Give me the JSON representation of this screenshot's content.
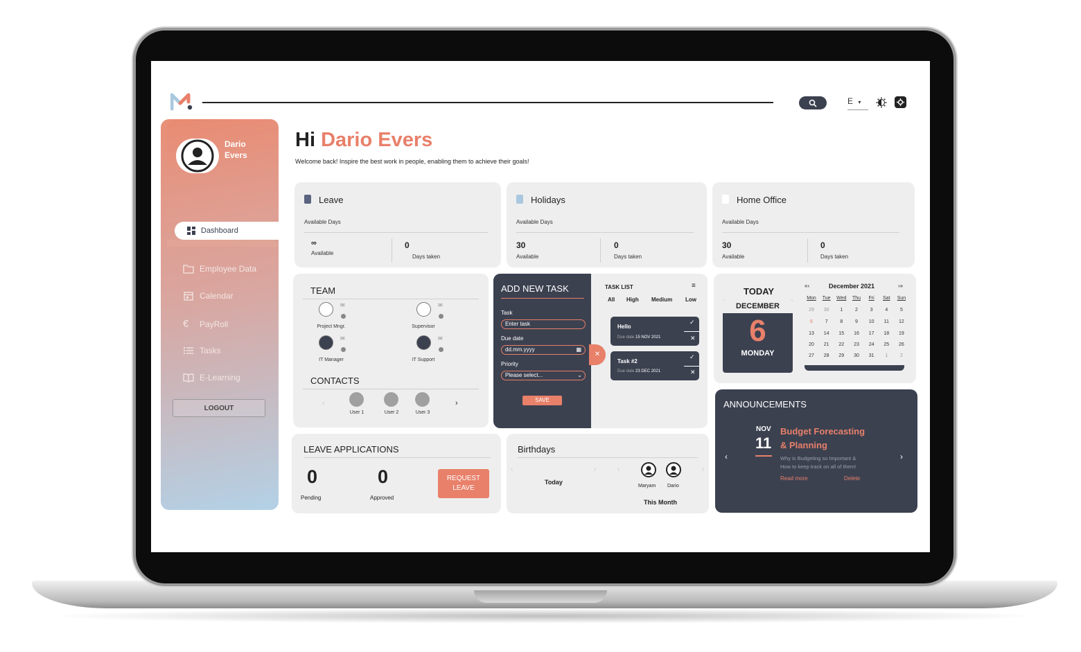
{
  "app": {
    "logo": "M-logo",
    "search_icon": "search-icon",
    "language": "E",
    "colors": {
      "accent": "#e8806a",
      "dark": "#3c4150",
      "card": "#eeeeee",
      "sidebar_top": "#e88f77",
      "sidebar_bottom": "#b3d1e6"
    }
  },
  "sidebar": {
    "user_first": "Dario",
    "user_last": "Evers",
    "active": "Dashboard",
    "items": [
      {
        "label": "Employee Data",
        "icon": "folder-icon"
      },
      {
        "label": "Calendar",
        "icon": "calendar-icon"
      },
      {
        "label": "PayRoll",
        "icon": "euro-icon"
      },
      {
        "label": "Tasks",
        "icon": "list-icon"
      },
      {
        "label": "E-Learning",
        "icon": "book-icon"
      }
    ],
    "logout": "LOGOUT"
  },
  "greeting": {
    "hi": "Hi",
    "name": "Dario Evers",
    "subtitle": "Welcome back! Inspire the best work in people, enabling them to achieve their goals!"
  },
  "stats": [
    {
      "title": "Leave",
      "subtitle": "Available Days",
      "available": "∞",
      "available_label": "Available",
      "taken": "0",
      "taken_label": "Days taken",
      "color": "#5a6480"
    },
    {
      "title": "Holidays",
      "subtitle": "Available Days",
      "available": "30",
      "available_label": "Available",
      "taken": "0",
      "taken_label": "Days taken",
      "color": "#a9c8df"
    },
    {
      "title": "Home Office",
      "subtitle": "Available Days",
      "available": "30",
      "available_label": "Available",
      "taken": "0",
      "taken_label": "Days taken",
      "color": "#ffffff"
    }
  ],
  "team": {
    "title": "TEAM",
    "members": [
      "Project Mngr.",
      "Supervisor",
      "IT Manager",
      "IT Support"
    ],
    "contacts_title": "CONTACTS",
    "contacts": [
      "User 1",
      "User 2",
      "User 3"
    ]
  },
  "add_task": {
    "title": "ADD NEW TASK",
    "task_label": "Task",
    "task_placeholder": "Enter task",
    "due_label": "Due date",
    "due_placeholder": "dd.mm.yyyy",
    "priority_label": "Priority",
    "priority_value": "Please select...",
    "save": "SAVE"
  },
  "task_list": {
    "title": "TASK LIST",
    "filters": [
      "All",
      "High",
      "Medium",
      "Low"
    ],
    "tasks": [
      {
        "name": "Hello",
        "due_label": "Due date",
        "due": "15 NOV 2021"
      },
      {
        "name": "Task #2",
        "due_label": "Due date",
        "due": "23 DEC 2021"
      }
    ]
  },
  "today": {
    "title": "TODAY",
    "month": "DECEMBER",
    "day": "6",
    "weekday": "MONDAY"
  },
  "calendar": {
    "month": "December 2021",
    "prev": "«‹",
    "next": "›»",
    "weekdays": [
      "Mon",
      "Tue",
      "Wed",
      "Thu",
      "Fri",
      "Sat",
      "Sun"
    ],
    "weeks": [
      [
        "29",
        "30",
        "1",
        "2",
        "3",
        "4",
        "5"
      ],
      [
        "6",
        "7",
        "8",
        "9",
        "10",
        "11",
        "12"
      ],
      [
        "13",
        "14",
        "15",
        "16",
        "17",
        "18",
        "19"
      ],
      [
        "20",
        "21",
        "22",
        "23",
        "24",
        "25",
        "26"
      ],
      [
        "27",
        "28",
        "29",
        "30",
        "31",
        "1",
        "2"
      ]
    ]
  },
  "leave_apps": {
    "title": "LEAVE APPLICATIONS",
    "pending": "0",
    "pending_label": "Pending",
    "approved": "0",
    "approved_label": "Approved",
    "request_line1": "REQUEST",
    "request_line2": "LEAVE"
  },
  "birthdays": {
    "title": "Birthdays",
    "today": "Today",
    "this_month": "This Month",
    "people": [
      "Maryam",
      "Dario"
    ]
  },
  "announcements": {
    "title": "ANNOUNCEMENTS",
    "month": "NOV",
    "day": "11",
    "headline1": "Budget Forecasting",
    "headline2": "& Planning",
    "body1": "Why is Budgeting so Important &",
    "body2": "How to keep track on all of them!",
    "read_more": "Read more",
    "delete": "Delete"
  }
}
